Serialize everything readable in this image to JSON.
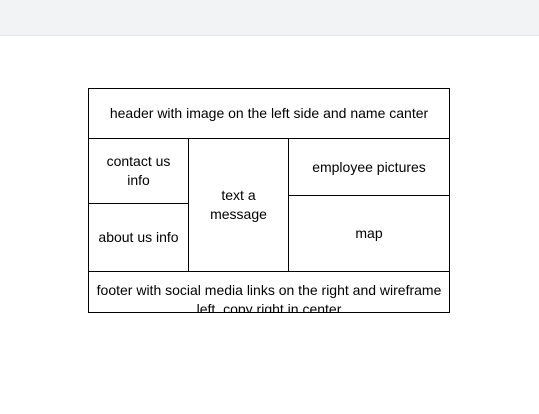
{
  "diagram": {
    "header": "header with image on the left side and name canter",
    "contact": "contact us info",
    "about": "about us info",
    "text_message": "text a message",
    "employee_pictures": "employee pictures",
    "map": "map",
    "footer": "footer with social media links on the right and wireframe left. copy right in center"
  },
  "colors": {
    "top_bar": "#f1f3f4",
    "border": "#000000",
    "background": "#ffffff"
  }
}
